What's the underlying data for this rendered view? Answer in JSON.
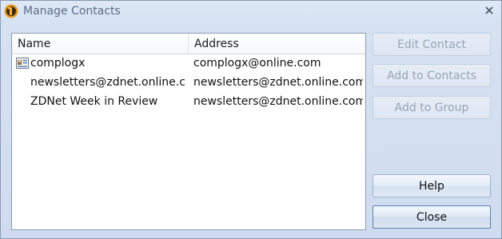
{
  "window": {
    "title": "Manage Contacts",
    "accent_color": "#5a6e8a",
    "icon": "app-logo-icon"
  },
  "list": {
    "columns": [
      "Name",
      "Address"
    ],
    "rows": [
      {
        "name": "complogx",
        "address": "complogx@online.com",
        "icon": "contact-card-icon"
      },
      {
        "name": "newsletters@zdnet.online.c...",
        "address": "newsletters@zdnet.online.com",
        "icon": ""
      },
      {
        "name": "ZDNet Week in Review",
        "address": "newsletters@zdnet.online.com",
        "icon": ""
      }
    ]
  },
  "buttons": {
    "edit_contact": "Edit Contact",
    "add_to_contacts": "Add to Contacts",
    "add_to_group": "Add to Group",
    "help": "Help",
    "close": "Close"
  }
}
